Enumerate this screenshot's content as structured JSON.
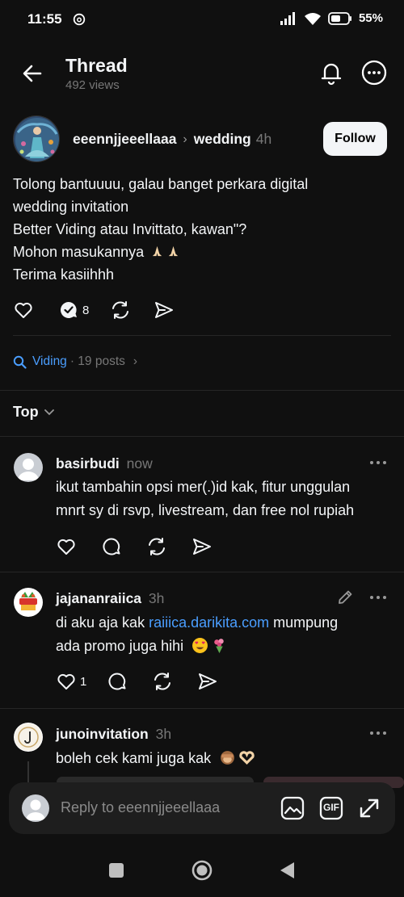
{
  "status": {
    "time": "11:55",
    "battery": "55%"
  },
  "header": {
    "title": "Thread",
    "views": "492 views"
  },
  "post": {
    "username": "eeennjjeeellaaa",
    "topic": "wedding",
    "time": "4h",
    "follow_label": "Follow",
    "lines": [
      "Tolong bantuuuu, galau banget perkara digital",
      "wedding invitation",
      "Better Viding atau Invittato, kawan\"?",
      "Mohon masukannya",
      "Terima kasiihhh"
    ],
    "reply_count": "8"
  },
  "topic_link": {
    "name": "Viding",
    "count": "· 19 posts"
  },
  "sort": {
    "label": "Top"
  },
  "replies": [
    {
      "username": "basirbudi",
      "time": "now",
      "lines": [
        "ikut tambahin opsi mer(.)id kak, fitur unggulan",
        "mnrt sy di rsvp, livestream, dan free nol rupiah"
      ],
      "like_count": ""
    },
    {
      "username": "jajananraiica",
      "time": "3h",
      "line1_prefix": "di aku aja kak ",
      "line1_link": "raiiica.darikita.com",
      "line1_suffix": " mumpung",
      "line2": "ada promo juga hihi",
      "like_count": "1"
    },
    {
      "username": "junoinvitation",
      "time": "3h",
      "lines": [
        "boleh cek kami juga kak"
      ]
    }
  ],
  "composer": {
    "placeholder": "Reply to eeennjjeeellaaa",
    "gif_label": "GIF"
  },
  "colors": {
    "background": "#101010",
    "link": "#4a9eff",
    "muted": "#777777"
  },
  "icons": [
    "back-arrow-icon",
    "bell-icon",
    "more-icon",
    "heart-icon",
    "comment-icon",
    "repost-icon",
    "share-icon",
    "search-icon",
    "chevron-down-icon",
    "pencil-icon",
    "image-icon",
    "gif-icon",
    "expand-icon"
  ]
}
